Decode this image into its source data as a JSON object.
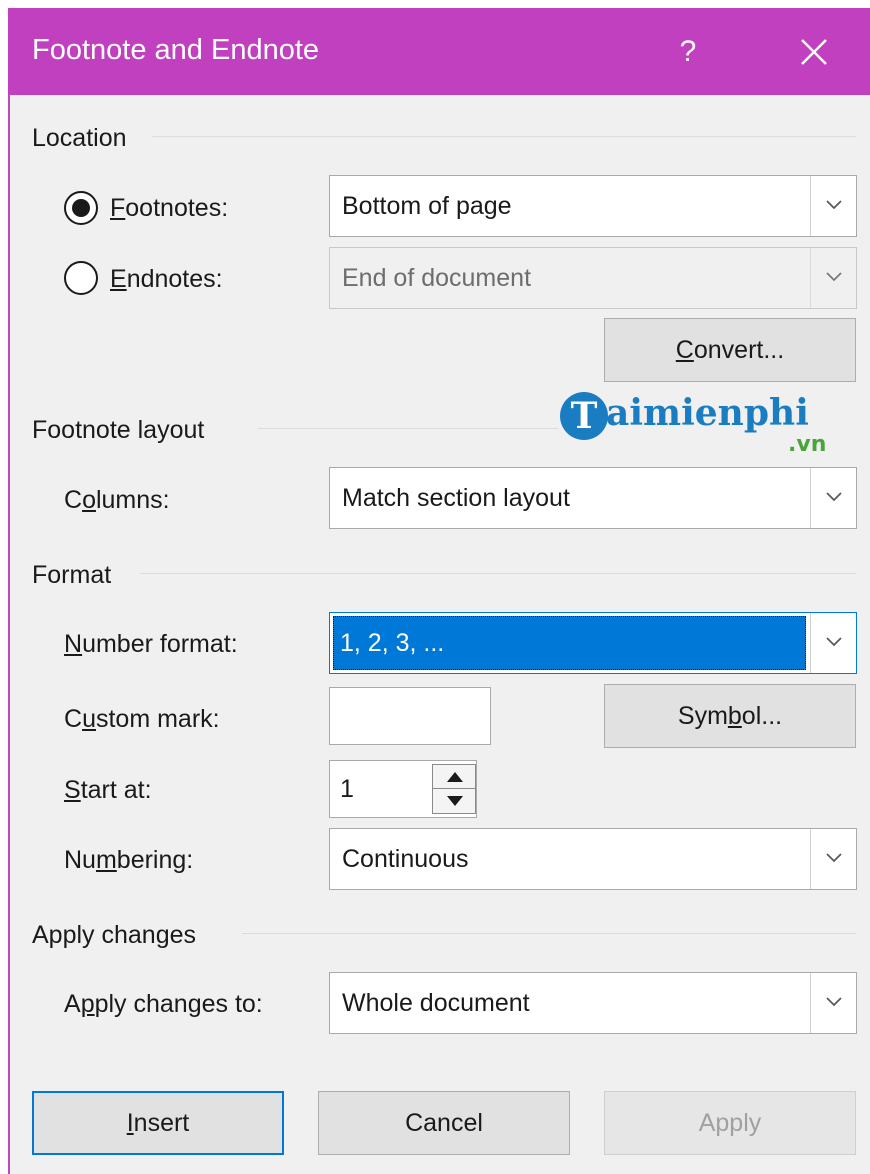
{
  "dialog": {
    "title": "Footnote and Endnote",
    "help_label": "?",
    "close_icon": "close-icon",
    "accent": "#c040c0"
  },
  "location": {
    "heading": "Location",
    "footnotes": {
      "label_key": "F",
      "label_rest": "ootnotes:",
      "selected": true,
      "value": "Bottom of page"
    },
    "endnotes": {
      "label_key": "E",
      "label_rest": "ndnotes:",
      "selected": false,
      "value": "End of document",
      "disabled": true
    },
    "convert": {
      "label_pre": "",
      "label_key": "C",
      "label_rest": "onvert..."
    }
  },
  "watermark": {
    "initial": "T",
    "word": "aimienphi",
    "tld": ".vn"
  },
  "footnote_layout": {
    "heading": "Footnote layout",
    "columns": {
      "label_pre": "C",
      "label_key": "o",
      "label_rest": "lumns:",
      "value": "Match section layout"
    }
  },
  "format": {
    "heading": "Format",
    "number_format": {
      "label_pre": "",
      "label_key": "N",
      "label_rest": "umber format:",
      "value": "1, 2, 3, ..."
    },
    "custom_mark": {
      "label_pre": "C",
      "label_key": "u",
      "label_rest": "stom mark:",
      "value": ""
    },
    "symbol": {
      "label_pre": "Sym",
      "label_key": "b",
      "label_rest": "ol..."
    },
    "start_at": {
      "label_pre": "",
      "label_key": "S",
      "label_rest": "tart at:",
      "value": "1"
    },
    "numbering": {
      "label_pre": "Nu",
      "label_key": "m",
      "label_rest": "bering:",
      "value": "Continuous"
    }
  },
  "apply_changes": {
    "heading": "Apply changes",
    "apply_to": {
      "label_pre": "A",
      "label_key": "p",
      "label_rest": "ply changes to:",
      "value": "Whole document"
    }
  },
  "buttons": {
    "insert": {
      "label_pre": "",
      "label_key": "I",
      "label_rest": "nsert"
    },
    "cancel": {
      "label": "Cancel"
    },
    "apply": {
      "label": "Apply",
      "disabled": true
    }
  }
}
